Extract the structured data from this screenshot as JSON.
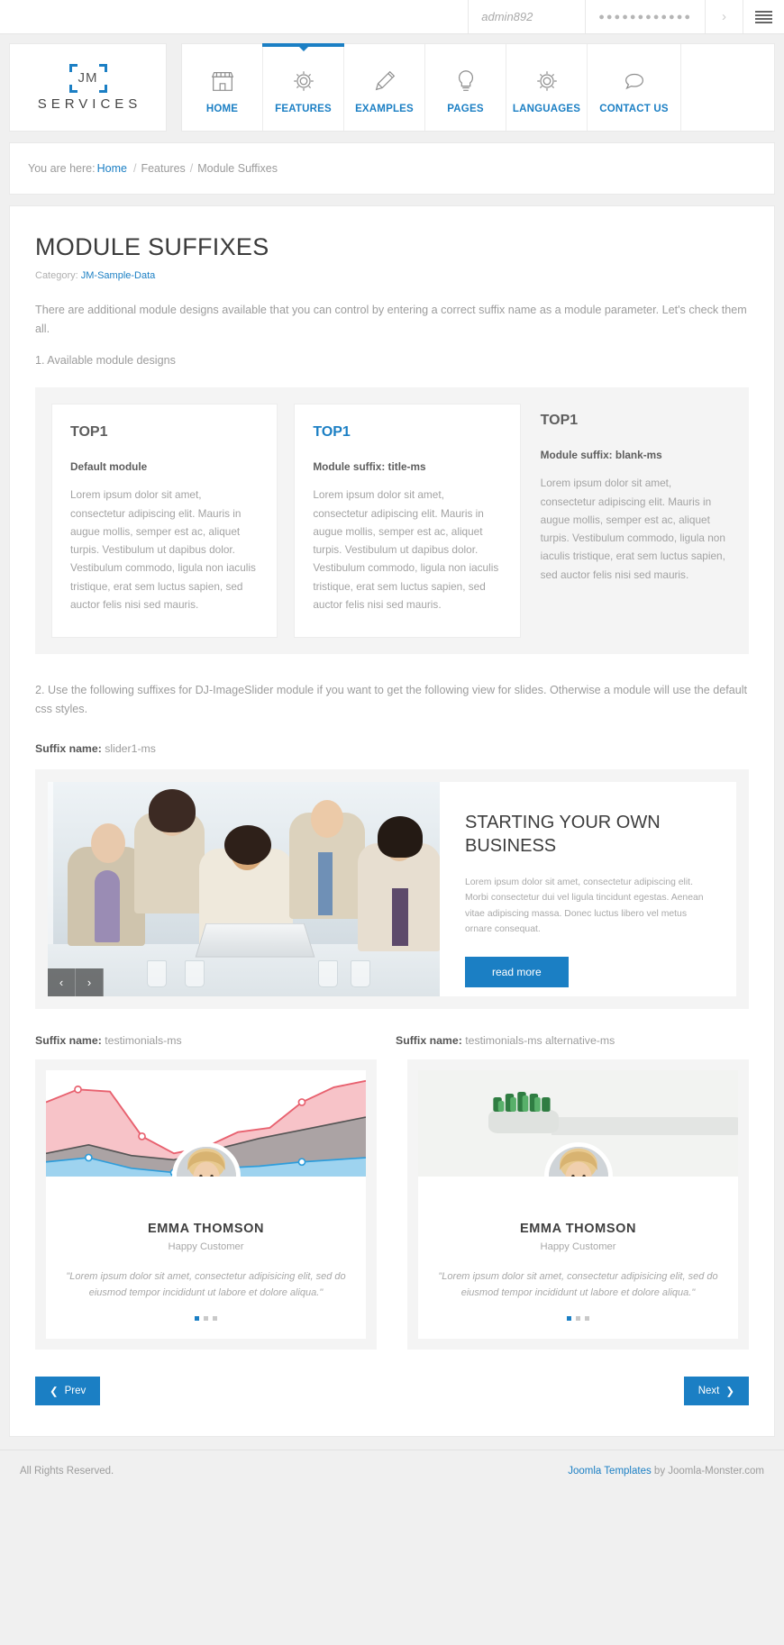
{
  "topbar": {
    "username_value": "admin892",
    "password_value": "●●●●●●●●●●●●",
    "username_placeholder": "admin892",
    "submit_icon": "chevron-right-icon",
    "menu_icon": "hamburger-icon"
  },
  "logo": {
    "mark_text": "JM",
    "name": "SERVICES"
  },
  "nav": {
    "items": [
      {
        "label": "HOME",
        "icon": "store-icon",
        "active": false
      },
      {
        "label": "FEATURES",
        "icon": "gear-icon",
        "active": true
      },
      {
        "label": "EXAMPLES",
        "icon": "pencil-icon",
        "active": false
      },
      {
        "label": "PAGES",
        "icon": "lightbulb-icon",
        "active": false
      },
      {
        "label": "LANGUAGES",
        "icon": "gear-icon",
        "active": false
      },
      {
        "label": "CONTACT US",
        "icon": "speech-bubble-icon",
        "active": false
      }
    ]
  },
  "breadcrumb": {
    "prefix": "You are here:",
    "home": "Home",
    "separator": "/",
    "features": "Features",
    "current": "Module Suffixes"
  },
  "article": {
    "title": "MODULE SUFFIXES",
    "category_label": "Category:",
    "category_value": "JM-Sample-Data",
    "intro": "There are additional module designs available that you can control by entering a correct suffix name as a module parameter. Let's check them all.",
    "section1_heading": "1. Available module designs",
    "section2_text": "2. Use the following suffixes for DJ-ImageSlider module if you want to get the following view for slides. Otherwise a module will use the default css styles."
  },
  "modules": [
    {
      "title": "TOP1",
      "subtitle": "Default module",
      "body": "Lorem ipsum dolor sit amet, consectetur adipiscing elit. Mauris in augue mollis, semper est ac, aliquet turpis. Vestibulum ut dapibus dolor. Vestibulum commodo, ligula non iaculis tristique, erat sem luctus sapien, sed auctor felis nisi sed mauris."
    },
    {
      "title": "TOP1",
      "subtitle": "Module suffix: title-ms",
      "body": "Lorem ipsum dolor sit amet, consectetur adipiscing elit. Mauris in augue mollis, semper est ac, aliquet turpis. Vestibulum ut dapibus dolor. Vestibulum commodo, ligula non iaculis tristique, erat sem luctus sapien, sed auctor felis nisi sed mauris."
    },
    {
      "title": "TOP1",
      "subtitle": "Module suffix: blank-ms",
      "body": "Lorem ipsum dolor sit amet, consectetur adipiscing elit. Mauris in augue mollis, semper est ac, aliquet turpis. Vestibulum commodo, ligula non iaculis tristique, erat sem luctus sapien, sed auctor felis nisi sed mauris."
    }
  ],
  "slider": {
    "suffix_prefix": "Suffix name:",
    "suffix_value": "slider1-ms",
    "caption_title": "STARTING YOUR OWN BUSINESS",
    "caption_text": "Lorem ipsum dolor sit amet, consectetur adipiscing elit. Morbi consectetur dui vel ligula tincidunt egestas. Aenean vitae adipiscing massa. Donec luctus libero vel metus ornare consequat.",
    "button_label": "read more",
    "prev_icon": "chevron-left-icon",
    "next_icon": "chevron-right-icon",
    "prev_glyph": "‹",
    "next_glyph": "›"
  },
  "testimonials": {
    "suffix_prefix": "Suffix name:",
    "suffix_left": "testimonials-ms",
    "suffix_right": "testimonials-ms alternative-ms",
    "cards": [
      {
        "name": "EMMA THOMSON",
        "role": "Happy Customer",
        "quote": "\"Lorem ipsum dolor sit amet, consectetur adipisicing elit, sed do eiusmod tempor incididunt ut labore et dolore aliqua.\"",
        "image": "line-chart-image",
        "dots": 3,
        "active_dot": 0
      },
      {
        "name": "EMMA THOMSON",
        "role": "Happy Customer",
        "quote": "\"Lorem ipsum dolor sit amet, consectetur adipisicing elit, sed do eiusmod tempor incididunt ut labore et dolore aliqua.\"",
        "image": "toothbrush-image",
        "dots": 3,
        "active_dot": 0
      }
    ]
  },
  "pager": {
    "prev_label": "Prev",
    "next_label": "Next",
    "prev_glyph": "❮",
    "next_glyph": "❯"
  },
  "footer": {
    "left": "All Rights Reserved.",
    "right_link": "Joomla Templates",
    "right_text": " by Joomla-Monster.com"
  },
  "colors": {
    "accent": "#1b7fc4",
    "page_bg": "#f0f0f0",
    "panel_bg": "#ffffff",
    "band_bg": "#f4f4f4",
    "text_muted": "#9c9c9c"
  }
}
